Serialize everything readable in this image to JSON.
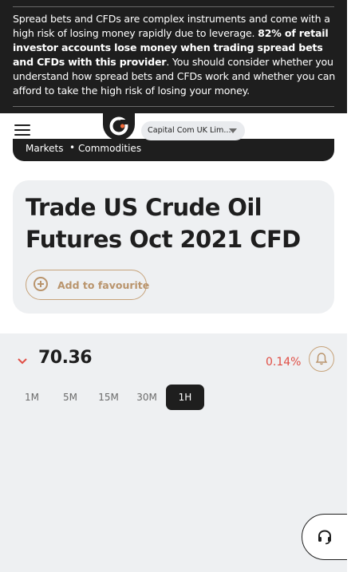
{
  "risk_warning": {
    "part1": "Spread bets and CFDs are complex instruments and come with a high risk of losing money rapidly due to leverage. ",
    "bold": "82% of retail investor accounts lose money when trading spread bets and CFDs with this provider",
    "part2": ". You should consider whether you understand how spread bets and CFDs work and whether you can afford to take the high risk of losing your money."
  },
  "header": {
    "menu_icon": "hamburger-icon",
    "logo_icon": "capital-com-logo",
    "entity_label": "Capital Com UK Lim...",
    "entity_caret_icon": "caret-down-icon"
  },
  "breadcrumb": {
    "items": [
      "Markets",
      "Commodities"
    ],
    "separator": "•"
  },
  "instrument": {
    "title": "Trade US Crude Oil Futures Oct 2021 CFD",
    "favourite_label": "Add to favourite"
  },
  "quote": {
    "direction_icon": "chevron-down-icon",
    "price": "70.36",
    "change": "0.14%",
    "alert_icon": "bell-icon"
  },
  "timeframes": [
    {
      "label": "1M",
      "active": false
    },
    {
      "label": "5M",
      "active": false
    },
    {
      "label": "15M",
      "active": false
    },
    {
      "label": "30M",
      "active": false
    },
    {
      "label": "1H",
      "active": true
    }
  ],
  "support_icon": "headset-icon",
  "colors": {
    "dark": "#1e1e1e",
    "accent": "#b9946c",
    "negative": "#e04e45",
    "panel": "#eef0f2"
  }
}
